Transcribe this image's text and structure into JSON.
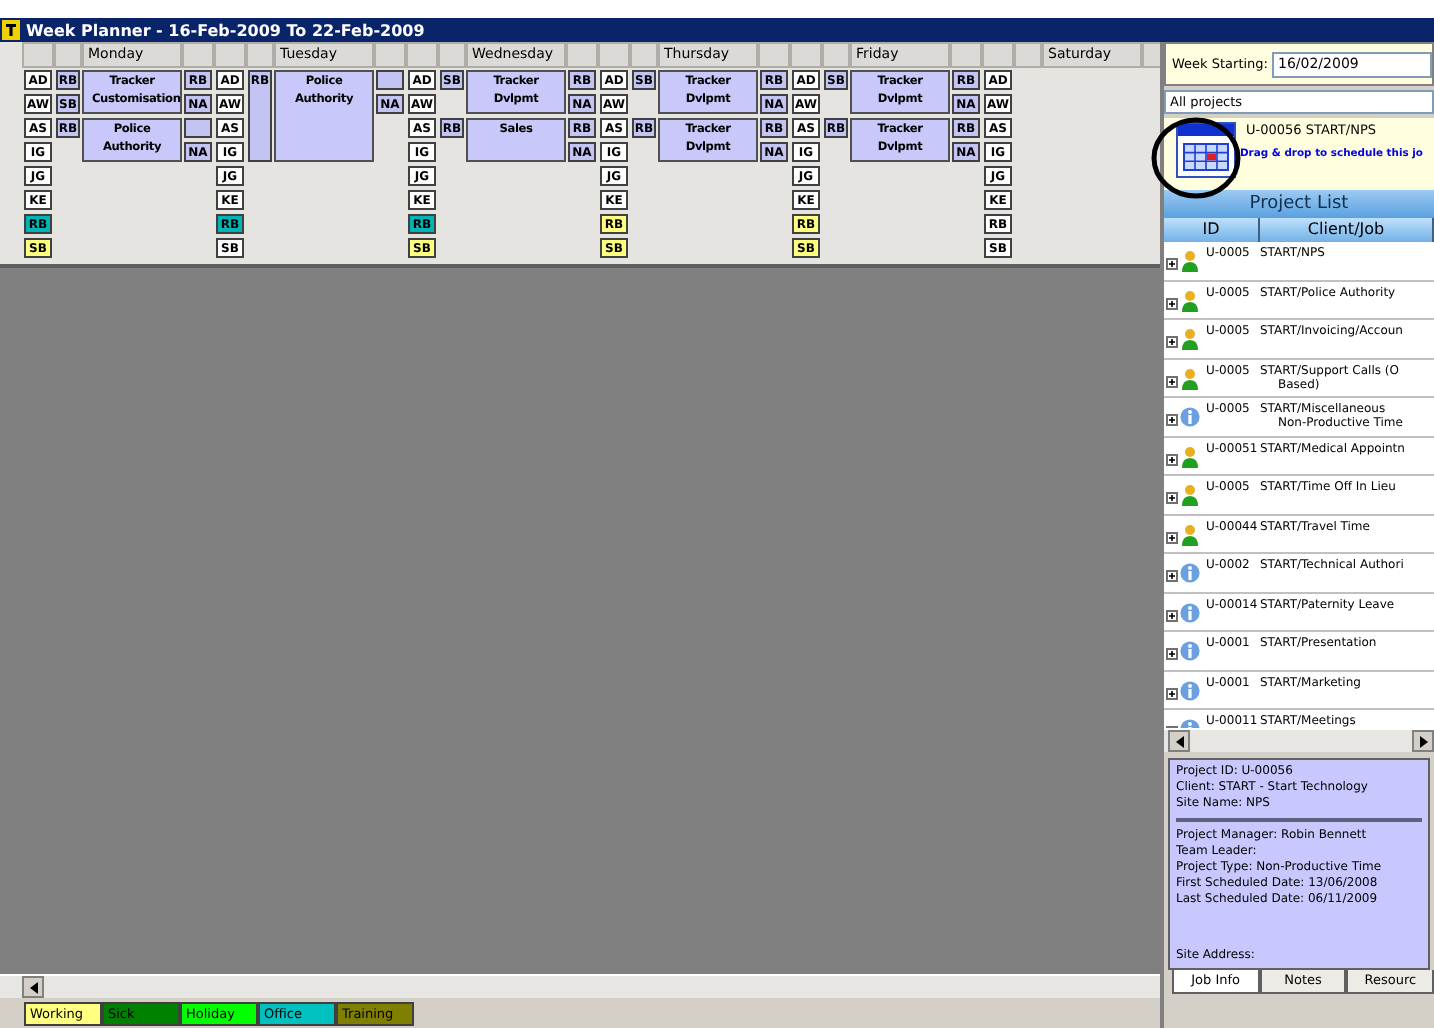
{
  "window": {
    "title": "Week Planner - 16-Feb-2009 To 22-Feb-2009"
  },
  "days": [
    {
      "name": "Monday",
      "staff": [
        {
          "initials": "AD",
          "color": "#ffffff"
        },
        {
          "initials": "AW",
          "color": "#ffffff"
        },
        {
          "initials": "AS",
          "color": "#ffffff"
        },
        {
          "initials": "IG",
          "color": "#ffffff"
        },
        {
          "initials": "JG",
          "color": "#ffffff"
        },
        {
          "initials": "KE",
          "color": "#ffffff"
        },
        {
          "initials": "RB",
          "color": "#00b4b4"
        },
        {
          "initials": "SB",
          "color": "#ffff80"
        }
      ],
      "left": [
        {
          "kind": "badge",
          "text": "RB"
        },
        {
          "kind": "badge",
          "text": "SB"
        },
        {
          "kind": "badge",
          "text": "RB"
        },
        {
          "kind": "none"
        }
      ],
      "jobs": [
        {
          "kind": "half",
          "title": "Tracker Customisation"
        },
        {
          "kind": "half",
          "title": "Police Authority"
        }
      ],
      "right": [
        {
          "kind": "badge",
          "text": "RB"
        },
        {
          "kind": "badge",
          "text": "NA"
        },
        {
          "kind": "block"
        },
        {
          "kind": "badge",
          "text": "NA"
        }
      ]
    },
    {
      "name": "Tuesday",
      "staff": [
        {
          "initials": "AD",
          "color": "#ffffff"
        },
        {
          "initials": "AW",
          "color": "#ffffff"
        },
        {
          "initials": "AS",
          "color": "#ffffff"
        },
        {
          "initials": "IG",
          "color": "#ffffff"
        },
        {
          "initials": "JG",
          "color": "#ffffff"
        },
        {
          "initials": "KE",
          "color": "#ffffff"
        },
        {
          "initials": "RB",
          "color": "#00b4b4"
        },
        {
          "initials": "SB",
          "color": "#ffffff"
        }
      ],
      "left": [
        {
          "kind": "tall",
          "text": "RB"
        }
      ],
      "jobs": [
        {
          "kind": "full",
          "title": "Police Authority"
        }
      ],
      "right": [
        {
          "kind": "block"
        },
        {
          "kind": "badge",
          "text": "NA"
        }
      ]
    },
    {
      "name": "Wednesday",
      "staff": [
        {
          "initials": "AD",
          "color": "#ffffff"
        },
        {
          "initials": "AW",
          "color": "#ffffff"
        },
        {
          "initials": "AS",
          "color": "#ffffff"
        },
        {
          "initials": "IG",
          "color": "#ffffff"
        },
        {
          "initials": "JG",
          "color": "#ffffff"
        },
        {
          "initials": "KE",
          "color": "#ffffff"
        },
        {
          "initials": "RB",
          "color": "#00b4b4"
        },
        {
          "initials": "SB",
          "color": "#ffff80"
        }
      ],
      "left": [
        {
          "kind": "badge",
          "text": "SB"
        },
        {
          "kind": "none"
        },
        {
          "kind": "badge",
          "text": "RB"
        },
        {
          "kind": "none"
        }
      ],
      "jobs": [
        {
          "kind": "half",
          "title": "Tracker Dvlpmt"
        },
        {
          "kind": "half",
          "title": "Sales"
        }
      ],
      "right": [
        {
          "kind": "badge",
          "text": "RB"
        },
        {
          "kind": "badge",
          "text": "NA"
        },
        {
          "kind": "badge",
          "text": "RB"
        },
        {
          "kind": "badge",
          "text": "NA"
        }
      ]
    },
    {
      "name": "Thursday",
      "staff": [
        {
          "initials": "AD",
          "color": "#ffffff"
        },
        {
          "initials": "AW",
          "color": "#ffffff"
        },
        {
          "initials": "AS",
          "color": "#ffffff"
        },
        {
          "initials": "IG",
          "color": "#ffffff"
        },
        {
          "initials": "JG",
          "color": "#ffffff"
        },
        {
          "initials": "KE",
          "color": "#ffffff"
        },
        {
          "initials": "RB",
          "color": "#ffff80"
        },
        {
          "initials": "SB",
          "color": "#ffff80"
        }
      ],
      "left": [
        {
          "kind": "badge",
          "text": "SB"
        },
        {
          "kind": "none"
        },
        {
          "kind": "badge",
          "text": "RB"
        },
        {
          "kind": "none"
        }
      ],
      "jobs": [
        {
          "kind": "half",
          "title": "Tracker Dvlpmt"
        },
        {
          "kind": "half",
          "title": "Tracker Dvlpmt"
        }
      ],
      "right": [
        {
          "kind": "badge",
          "text": "RB"
        },
        {
          "kind": "badge",
          "text": "NA"
        },
        {
          "kind": "badge",
          "text": "RB"
        },
        {
          "kind": "badge",
          "text": "NA"
        }
      ]
    },
    {
      "name": "Friday",
      "staff": [
        {
          "initials": "AD",
          "color": "#ffffff"
        },
        {
          "initials": "AW",
          "color": "#ffffff"
        },
        {
          "initials": "AS",
          "color": "#ffffff"
        },
        {
          "initials": "IG",
          "color": "#ffffff"
        },
        {
          "initials": "JG",
          "color": "#ffffff"
        },
        {
          "initials": "KE",
          "color": "#ffffff"
        },
        {
          "initials": "RB",
          "color": "#ffff80"
        },
        {
          "initials": "SB",
          "color": "#ffff80"
        }
      ],
      "left": [
        {
          "kind": "badge",
          "text": "SB"
        },
        {
          "kind": "none"
        },
        {
          "kind": "badge",
          "text": "RB"
        },
        {
          "kind": "none"
        }
      ],
      "jobs": [
        {
          "kind": "half",
          "title": "Tracker Dvlpmt"
        },
        {
          "kind": "half",
          "title": "Tracker Dvlpmt"
        }
      ],
      "right": [
        {
          "kind": "badge",
          "text": "RB"
        },
        {
          "kind": "badge",
          "text": "NA"
        },
        {
          "kind": "badge",
          "text": "RB"
        },
        {
          "kind": "badge",
          "text": "NA"
        }
      ]
    },
    {
      "name": "Saturday",
      "staff": [
        {
          "initials": "AD",
          "color": "#ffffff"
        },
        {
          "initials": "AW",
          "color": "#ffffff"
        },
        {
          "initials": "AS",
          "color": "#ffffff"
        },
        {
          "initials": "IG",
          "color": "#ffffff"
        },
        {
          "initials": "JG",
          "color": "#ffffff"
        },
        {
          "initials": "KE",
          "color": "#ffffff"
        },
        {
          "initials": "RB",
          "color": "#ffffff"
        },
        {
          "initials": "SB",
          "color": "#ffffff"
        }
      ]
    }
  ],
  "legend": [
    {
      "label": "Working",
      "color": "#ffff80"
    },
    {
      "label": "Sick",
      "color": "#008000"
    },
    {
      "label": "Holiday",
      "color": "#00ff00"
    },
    {
      "label": "Office",
      "color": "#00c0c0"
    },
    {
      "label": "Training",
      "color": "#808000"
    }
  ],
  "sidebar": {
    "week_label": "Week Starting:",
    "week_value": "16/02/2009",
    "filter": "All projects",
    "selected": {
      "title": "U-00056 START/NPS",
      "hint": "Drag & drop to schedule this jo"
    },
    "list_title": "Project List",
    "columns": [
      "ID",
      "Client/Job"
    ],
    "projects": [
      {
        "id": "U-0005",
        "lines": [
          "START/NPS"
        ],
        "kind": "person"
      },
      {
        "id": "U-0005",
        "lines": [
          "START/Police Authority"
        ],
        "kind": "person"
      },
      {
        "id": "U-0005",
        "lines": [
          "START/Invoicing/Accoun"
        ],
        "kind": "person"
      },
      {
        "id": "U-0005",
        "lines": [
          "START/Support Calls (O",
          "Based)"
        ],
        "kind": "person"
      },
      {
        "id": "U-0005",
        "lines": [
          "START/Miscellaneous",
          "Non-Productive Time"
        ],
        "kind": "info"
      },
      {
        "id": "U-00051",
        "lines": [
          "START/Medical Appointn"
        ],
        "kind": "person"
      },
      {
        "id": "U-0005",
        "lines": [
          "START/Time Off In Lieu"
        ],
        "kind": "person"
      },
      {
        "id": "U-00044",
        "lines": [
          "START/Travel Time"
        ],
        "kind": "person"
      },
      {
        "id": "U-0002",
        "lines": [
          "START/Technical Authori"
        ],
        "kind": "info"
      },
      {
        "id": "U-00014",
        "lines": [
          "START/Paternity Leave"
        ],
        "kind": "info"
      },
      {
        "id": "U-0001",
        "lines": [
          "START/Presentation"
        ],
        "kind": "info"
      },
      {
        "id": "U-0001",
        "lines": [
          "START/Marketing"
        ],
        "kind": "info"
      },
      {
        "id": "U-00011",
        "lines": [
          "START/Meetings"
        ],
        "kind": "info"
      }
    ],
    "details": {
      "top": [
        "Project ID: U-00056",
        "Client: START - Start Technology",
        "Site Name: NPS"
      ],
      "bottom": [
        "Project Manager: Robin Bennett",
        "Team Leader:",
        "Project Type: Non-Productive Time",
        "First Scheduled Date: 13/06/2008",
        "Last Scheduled Date: 06/11/2009"
      ],
      "footer": "Site Address:"
    },
    "tabs": [
      {
        "label": "Job Info",
        "selected": true
      },
      {
        "label": "Notes",
        "selected": false
      },
      {
        "label": "Resourc",
        "selected": false
      }
    ]
  }
}
